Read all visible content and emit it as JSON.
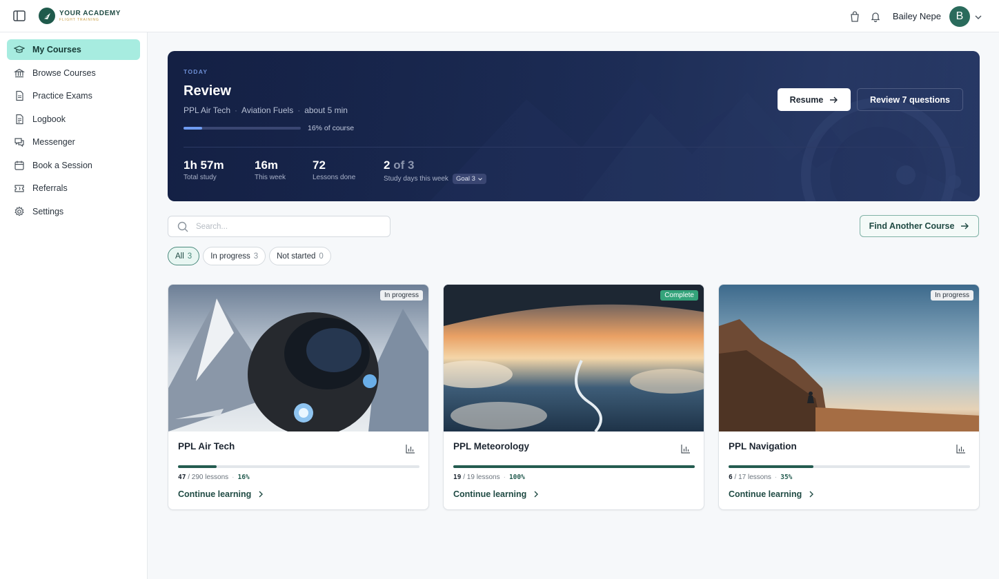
{
  "brand": {
    "title": "YOUR ACADEMY",
    "subtitle": "FLIGHT TRAINING",
    "color": "#1f5a4c"
  },
  "header": {
    "user_name": "Bailey Nepe",
    "avatar_initial": "B",
    "icons": [
      "sidebar-toggle-icon",
      "bag-icon",
      "bell-icon",
      "chevron-down-icon"
    ]
  },
  "sidebar": {
    "items": [
      {
        "label": "My Courses",
        "icon": "graduation-cap-icon",
        "active": true
      },
      {
        "label": "Browse Courses",
        "icon": "library-icon"
      },
      {
        "label": "Practice Exams",
        "icon": "exam-icon"
      },
      {
        "label": "Logbook",
        "icon": "document-icon"
      },
      {
        "label": "Messenger",
        "icon": "chat-icon"
      },
      {
        "label": "Book a Session",
        "icon": "calendar-icon"
      },
      {
        "label": "Referrals",
        "icon": "ticket-icon"
      },
      {
        "label": "Settings",
        "icon": "gear-icon"
      }
    ]
  },
  "hero": {
    "tag": "TODAY",
    "title": "Review",
    "meta": [
      "PPL Air Tech",
      "Aviation Fuels",
      "about 5 min"
    ],
    "progress_percent": 16,
    "progress_label": "16% of course",
    "stats": [
      {
        "value": "1h 57m",
        "label": "Total study"
      },
      {
        "value": "16m",
        "label": "This week"
      },
      {
        "value": "72",
        "label": "Lessons done"
      },
      {
        "value": "2",
        "value_suffix": "of 3",
        "label": "Study days this week",
        "goal_label": "Goal 3"
      }
    ],
    "resume_label": "Resume",
    "review_label": "Review 7 questions"
  },
  "search": {
    "placeholder": "Search..."
  },
  "find_button": "Find Another Course",
  "filters": [
    {
      "label": "All",
      "count": "3",
      "active": true
    },
    {
      "label": "In progress",
      "count": "3"
    },
    {
      "label": "Not started",
      "count": "0"
    }
  ],
  "courses": [
    {
      "title": "PPL Air Tech",
      "badge": "In progress",
      "done": "47",
      "total": "290 lessons",
      "percent_label": "16%",
      "percent": 16,
      "link": "Continue learning"
    },
    {
      "title": "PPL Meteorology",
      "badge": "Complete",
      "done": "19",
      "total": "19 lessons",
      "percent_label": "100%",
      "percent": 100,
      "link": "Continue learning"
    },
    {
      "title": "PPL Navigation",
      "badge": "In progress",
      "done": "6",
      "total": "17 lessons",
      "percent_label": "35%",
      "percent": 35,
      "link": "Continue learning"
    }
  ]
}
